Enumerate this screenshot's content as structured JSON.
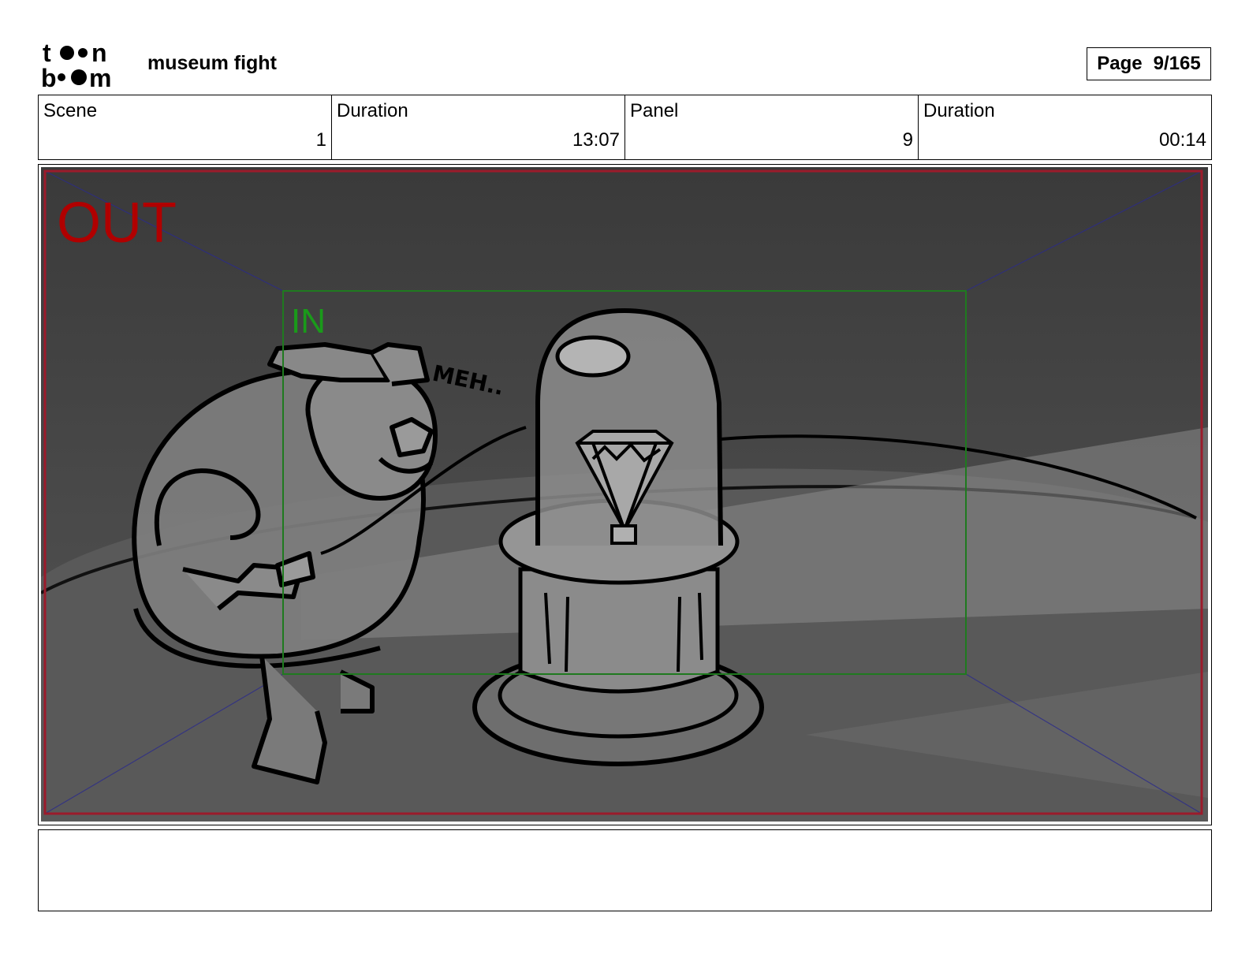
{
  "header": {
    "logo_text": "toon boom",
    "title": "museum fight",
    "page_label": "Page",
    "page_value": "9/165"
  },
  "info": {
    "scene_label": "Scene",
    "scene_value": "1",
    "scene_duration_label": "Duration",
    "scene_duration_value": "13:07",
    "panel_label": "Panel",
    "panel_value": "9",
    "panel_duration_label": "Duration",
    "panel_duration_value": "00:14"
  },
  "panel": {
    "out_label": "OUT",
    "in_label": "IN",
    "speech_text": "MEH..",
    "out_color": "#b00000",
    "in_color": "#1a9a1a"
  },
  "notes": {
    "text": ""
  }
}
